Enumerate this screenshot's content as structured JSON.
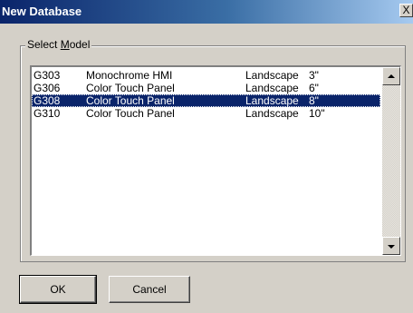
{
  "window": {
    "title": "New Database",
    "close_glyph": "X"
  },
  "group": {
    "label_prefix": "Select ",
    "label_underlined": "M",
    "label_suffix": "odel"
  },
  "models": [
    {
      "model": "G303",
      "description": "Monochrome HMI",
      "orientation": "Landscape",
      "size": "3\"",
      "selected": false
    },
    {
      "model": "G306",
      "description": "Color Touch Panel",
      "orientation": "Landscape",
      "size": "6\"",
      "selected": false
    },
    {
      "model": "G308",
      "description": "Color Touch Panel",
      "orientation": "Landscape",
      "size": "8\"",
      "selected": true
    },
    {
      "model": "G310",
      "description": "Color Touch Panel",
      "orientation": "Landscape",
      "size": "10\"",
      "selected": false
    }
  ],
  "buttons": {
    "ok": "OK",
    "cancel": "Cancel"
  },
  "icons": {
    "close": "close-icon",
    "scroll_up": "scroll-up-arrow-icon",
    "scroll_down": "scroll-down-arrow-icon"
  },
  "colors": {
    "title_gradient_start": "#0a246a",
    "title_gradient_end": "#a6caf0",
    "selection": "#0a246a",
    "dialog_bg": "#d4d0c8"
  }
}
